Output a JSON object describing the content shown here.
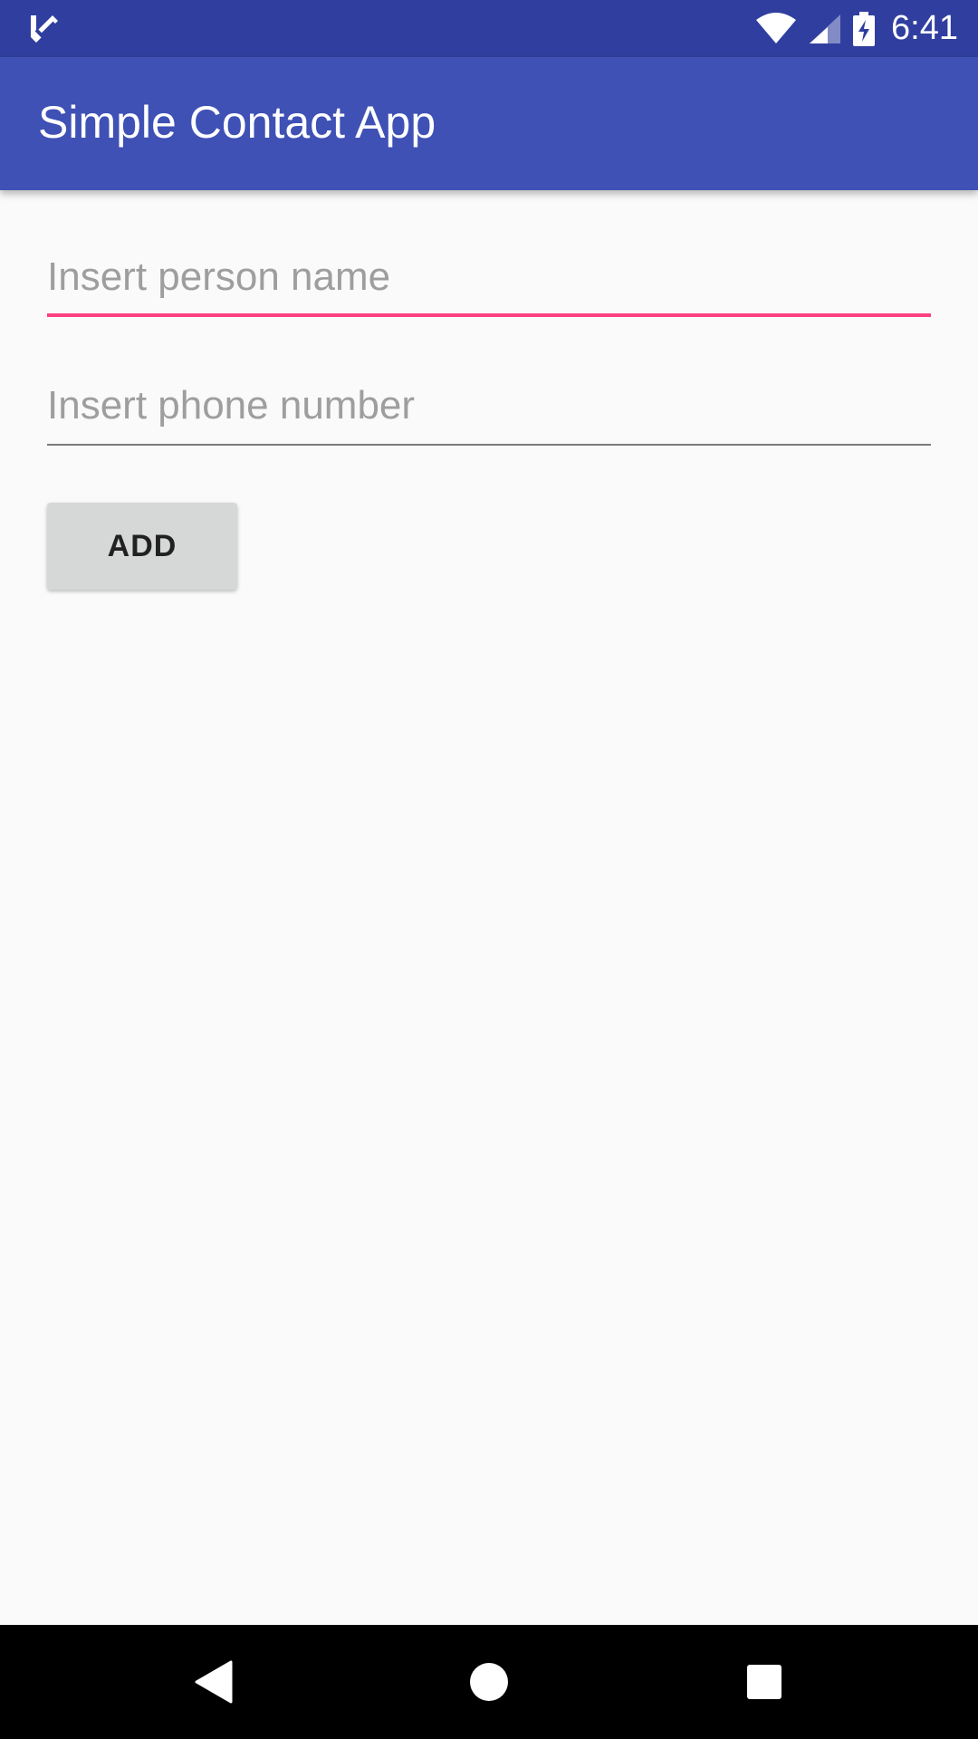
{
  "status_bar": {
    "time": "6:41",
    "icons": [
      "notification-check-icon",
      "wifi-icon",
      "cell-signal-icon",
      "battery-charging-icon"
    ],
    "background": "#303f9f"
  },
  "app_bar": {
    "title": "Simple Contact App",
    "background": "#3f51b5"
  },
  "form": {
    "name_field": {
      "value": "",
      "placeholder": "Insert person name",
      "focused": true,
      "accent": "#ff4081"
    },
    "phone_field": {
      "value": "",
      "placeholder": "Insert phone number",
      "focused": false
    },
    "add_button_label": "ADD"
  },
  "nav_bar": {
    "icons": [
      "back-icon",
      "home-icon",
      "recents-icon"
    ]
  }
}
